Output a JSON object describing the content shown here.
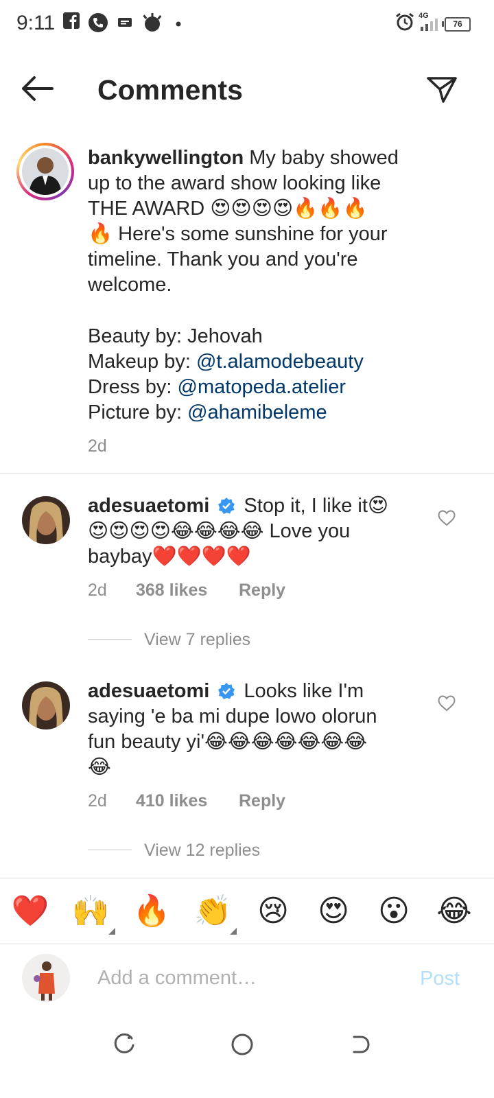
{
  "status_bar": {
    "time": "9:11",
    "network": "4G",
    "battery": "76"
  },
  "header": {
    "title": "Comments"
  },
  "caption": {
    "username": "bankywellington",
    "line1": "My baby showed",
    "line2": "up to the award show looking like",
    "line3": "THE AWARD 😍😍😍😍🔥🔥🔥",
    "line4": "🔥 Here's some sunshine for your",
    "line5": "timeline. Thank you and you're",
    "line6": "welcome.",
    "beauty_label": "Beauty by: Jehovah",
    "makeup_label": "Makeup by: ",
    "makeup_link": "@t.alamodebeauty",
    "dress_label": "Dress by: ",
    "dress_link": "@matopeda.atelier",
    "picture_label": "Picture by: ",
    "picture_link": "@ahamibeleme",
    "time": "2d"
  },
  "comments": [
    {
      "username": "adesuaetomi",
      "line1": "Stop it, I like it😍",
      "line2": "😍😍😍😍😂😂😂😂 Love you",
      "line3": "baybay❤️❤️❤️❤️",
      "time": "2d",
      "likes": "368 likes",
      "reply": "Reply",
      "view_replies": "View 7 replies"
    },
    {
      "username": "adesuaetomi",
      "line1": "Looks like I'm",
      "line2": "saying 'e ba mi dupe lowo olorun",
      "line3": "fun beauty yi'😂😂😂😂😂😂😂",
      "line4": "😂",
      "time": "2d",
      "likes": "410 likes",
      "reply": "Reply",
      "view_replies": "View 12 replies"
    }
  ],
  "reactions": [
    "❤️",
    "🙌",
    "🔥",
    "👏",
    "😢",
    "😍",
    "😮",
    "😂"
  ],
  "composer": {
    "placeholder": "Add a comment…",
    "post_label": "Post"
  },
  "colors": {
    "link": "#00376b",
    "muted": "#8e8e8e",
    "post_disabled": "#b2dffc",
    "verified": "#3897f0"
  }
}
